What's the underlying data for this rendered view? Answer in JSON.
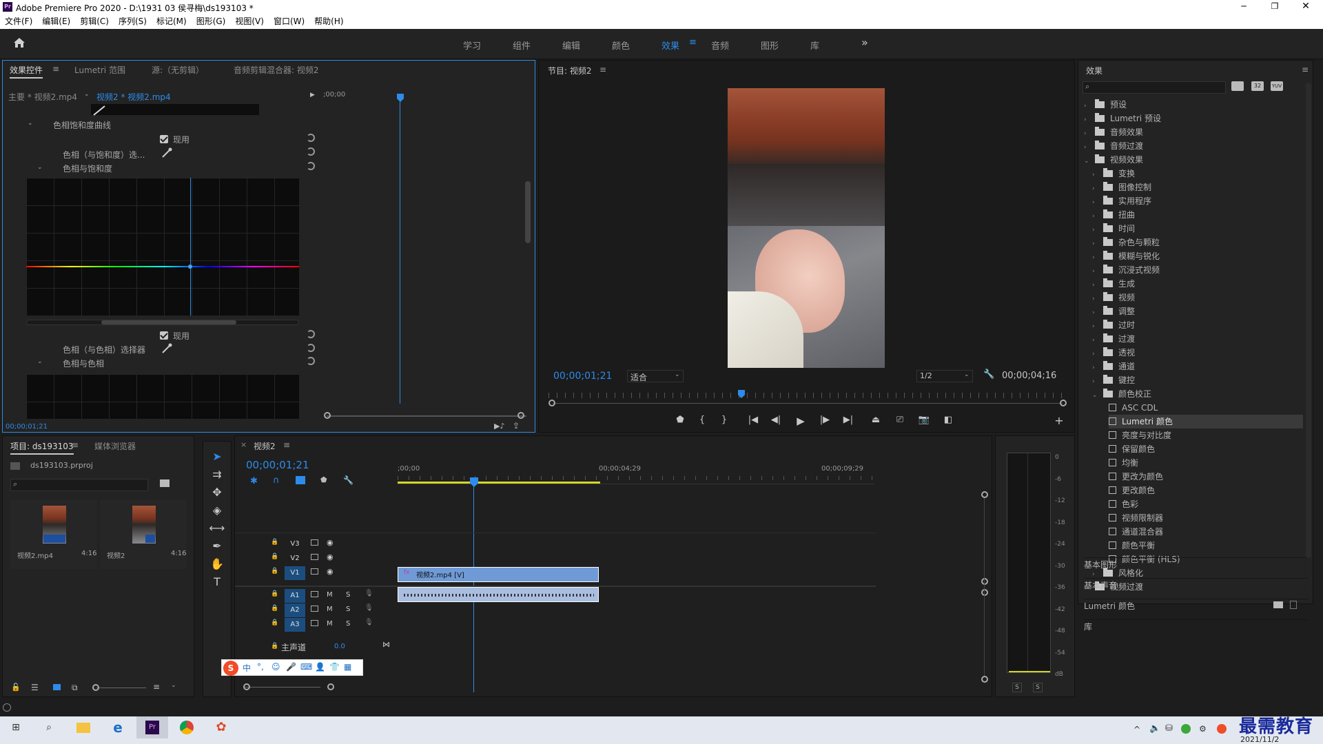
{
  "window": {
    "app_icon": "Pr",
    "title": "Adobe Premiere Pro 2020 - D:\\1931 03 侯寻梅\\ds193103 *"
  },
  "menu": [
    "文件(F)",
    "编辑(E)",
    "剪辑(C)",
    "序列(S)",
    "标记(M)",
    "图形(G)",
    "视图(V)",
    "窗口(W)",
    "帮助(H)"
  ],
  "workspaces": {
    "items": [
      "学习",
      "组件",
      "编辑",
      "颜色",
      "效果",
      "音频",
      "图形",
      "库"
    ],
    "active": "效果",
    "more": "»"
  },
  "effect_controls": {
    "tabs": [
      "效果控件",
      "Lumetri 范围",
      "源:（无剪辑）",
      "音频剪辑混合器: 视频2"
    ],
    "master_clip": "主要 * 视频2.mp4",
    "active_clip": "视频2 * 视频2.mp4",
    "timecode_ruler": ";00;00",
    "section_title": "色相饱和度曲线",
    "enable_label_1": "现用",
    "hue_vs_sat_selector": "色相（与饱和度）选...",
    "hue_vs_sat_label": "色相与饱和度",
    "enable_label_2": "现用",
    "hue_vs_hue_selector": "色相（与色相）选择器",
    "hue_vs_hue_label": "色相与色相",
    "current_time": "00;00;01;21"
  },
  "program": {
    "title": "节目: 视频2",
    "timecode": "00;00;01;21",
    "fit": "适合",
    "resolution": "1/2",
    "duration": "00;00;04;16"
  },
  "effects_panel": {
    "title": "效果",
    "items": [
      {
        "label": "预设",
        "level": 0,
        "type": "folder",
        "open": false
      },
      {
        "label": "Lumetri 预设",
        "level": 0,
        "type": "folder",
        "open": false
      },
      {
        "label": "音频效果",
        "level": 0,
        "type": "folder",
        "open": false
      },
      {
        "label": "音频过渡",
        "level": 0,
        "type": "folder",
        "open": false
      },
      {
        "label": "视频效果",
        "level": 0,
        "type": "folder",
        "open": true
      },
      {
        "label": "变换",
        "level": 1,
        "type": "folder",
        "open": false
      },
      {
        "label": "图像控制",
        "level": 1,
        "type": "folder",
        "open": false
      },
      {
        "label": "实用程序",
        "level": 1,
        "type": "folder",
        "open": false
      },
      {
        "label": "扭曲",
        "level": 1,
        "type": "folder",
        "open": false
      },
      {
        "label": "时间",
        "level": 1,
        "type": "folder",
        "open": false
      },
      {
        "label": "杂色与颗粒",
        "level": 1,
        "type": "folder",
        "open": false
      },
      {
        "label": "模糊与锐化",
        "level": 1,
        "type": "folder",
        "open": false
      },
      {
        "label": "沉浸式视频",
        "level": 1,
        "type": "folder",
        "open": false
      },
      {
        "label": "生成",
        "level": 1,
        "type": "folder",
        "open": false
      },
      {
        "label": "视频",
        "level": 1,
        "type": "folder",
        "open": false
      },
      {
        "label": "调整",
        "level": 1,
        "type": "folder",
        "open": false
      },
      {
        "label": "过时",
        "level": 1,
        "type": "folder",
        "open": false
      },
      {
        "label": "过渡",
        "level": 1,
        "type": "folder",
        "open": false
      },
      {
        "label": "透视",
        "level": 1,
        "type": "folder",
        "open": false
      },
      {
        "label": "通道",
        "level": 1,
        "type": "folder",
        "open": false
      },
      {
        "label": "键控",
        "level": 1,
        "type": "folder",
        "open": false
      },
      {
        "label": "颜色校正",
        "level": 1,
        "type": "folder",
        "open": true
      },
      {
        "label": "ASC CDL",
        "level": 2,
        "type": "effect"
      },
      {
        "label": "Lumetri 颜色",
        "level": 2,
        "type": "effect",
        "selected": true
      },
      {
        "label": "亮度与对比度",
        "level": 2,
        "type": "effect"
      },
      {
        "label": "保留颜色",
        "level": 2,
        "type": "effect"
      },
      {
        "label": "均衡",
        "level": 2,
        "type": "effect"
      },
      {
        "label": "更改为颜色",
        "level": 2,
        "type": "effect"
      },
      {
        "label": "更改颜色",
        "level": 2,
        "type": "effect"
      },
      {
        "label": "色彩",
        "level": 2,
        "type": "effect"
      },
      {
        "label": "视频限制器",
        "level": 2,
        "type": "effect"
      },
      {
        "label": "通道混合器",
        "level": 2,
        "type": "effect"
      },
      {
        "label": "颜色平衡",
        "level": 2,
        "type": "effect"
      },
      {
        "label": "颜色平衡 (HLS)",
        "level": 2,
        "type": "effect"
      },
      {
        "label": "风格化",
        "level": 1,
        "type": "folder",
        "open": false
      },
      {
        "label": "视频过渡",
        "level": 0,
        "type": "folder",
        "open": false
      }
    ],
    "sections": [
      "基本图形",
      "基本声音",
      "Lumetri 颜色",
      "库"
    ]
  },
  "project": {
    "tabs": [
      "项目: ds193103",
      "媒体浏览器"
    ],
    "file": "ds193103.prproj",
    "items": [
      {
        "name": "视频2.mp4",
        "duration": "4:16"
      },
      {
        "name": "视频2",
        "duration": "4:16"
      }
    ]
  },
  "timeline": {
    "tab": "视频2",
    "timecode": "00;00;01;21",
    "ruler": [
      ";00;00",
      "00;00;04;29",
      "00;00;09;29"
    ],
    "video_tracks": [
      "V3",
      "V2",
      "V1"
    ],
    "audio_tracks": [
      "A1",
      "A2",
      "A3"
    ],
    "master": "主声道",
    "master_value": "0.0",
    "clip_video": "视频2.mp4 [V]",
    "track_mute": "M",
    "track_solo": "S"
  },
  "meter": {
    "labels": [
      "0",
      "-6",
      "-12",
      "-18",
      "-24",
      "-30",
      "-36",
      "-42",
      "-48",
      "-54",
      "dB"
    ],
    "solo": [
      "S",
      "S"
    ]
  },
  "ime_bar": [
    "中",
    "°,",
    "☺",
    "🎤",
    "⌨",
    "👤",
    "👕",
    "▦"
  ],
  "taskbar": {
    "time": "",
    "date": "2021/11/2",
    "watermark": "最需教育"
  },
  "colors": {
    "accent": "#2d8ceb",
    "clip_video": "#6f9ad6",
    "clip_audio": "#a9bde0",
    "work_area": "#d6d62a"
  }
}
